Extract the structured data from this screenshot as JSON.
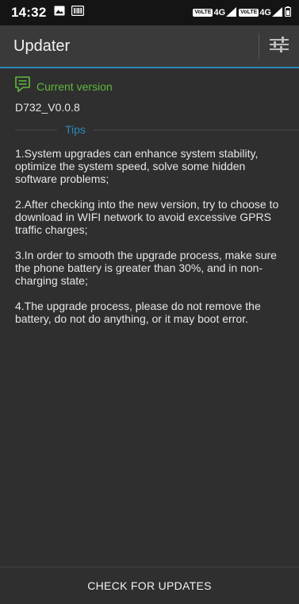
{
  "status_bar": {
    "time": "14:32",
    "icons": [
      "image-icon",
      "barcode-icon",
      "signal-icon",
      "signal-icon",
      "battery-icon"
    ],
    "sim1_network": "4G",
    "sim2_network": "4G",
    "volte_label": "VoLTE"
  },
  "app_bar": {
    "title": "Updater",
    "settings_icon": "sliders-icon"
  },
  "current_version": {
    "label": "Current version",
    "value": "D732_V0.0.8",
    "icon": "message-icon"
  },
  "tips": {
    "label": "Tips",
    "items": [
      "1.System upgrades can enhance system stability, optimize the system speed, solve some hidden software problems;",
      " 2.After checking into the new version, try to choose to download in WIFI network to avoid excessive GPRS traffic charges;",
      " 3.In order to smooth the upgrade process, make sure the phone battery is greater than 30%, and in non-charging state;",
      " 4.The upgrade process, please do not remove the battery, do not do anything, or it may boot error."
    ]
  },
  "check_button": {
    "label": "CHECK FOR UPDATES"
  },
  "colors": {
    "accent_blue": "#2a88b8",
    "accent_green": "#5fb83d",
    "background": "#2f2f2f",
    "app_bar": "#3a3a3a"
  }
}
